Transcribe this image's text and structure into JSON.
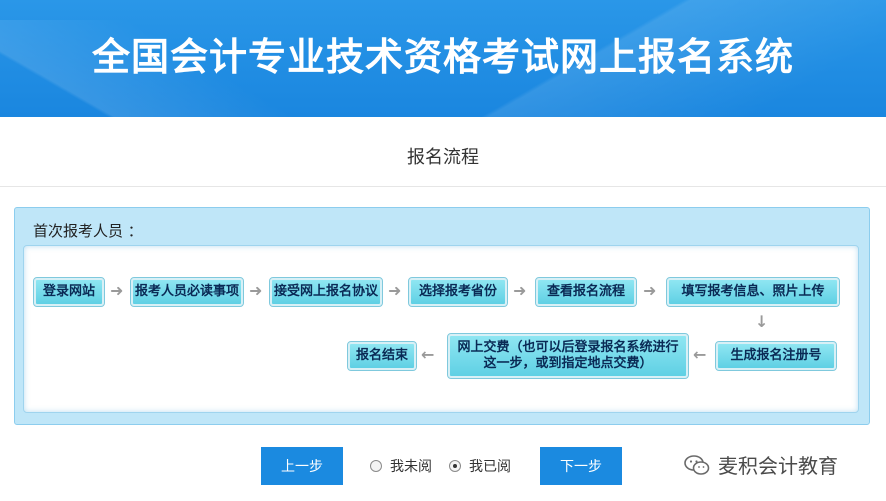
{
  "header": {
    "title": "全国会计专业技术资格考试网上报名系统"
  },
  "section": {
    "title": "报名流程"
  },
  "flow": {
    "label": "首次报考人员 ：",
    "steps_row1": [
      "登录网站",
      "报考人员必读事项",
      "接受网上报名协议",
      "选择报考省份",
      "查看报名流程",
      "填写报考信息、照片上传"
    ],
    "step_register": "生成报名注册号",
    "step_pay": "网上交费（也可以后登录报名系统进行这一步，或到指定地点交费）",
    "step_end": "报名结束"
  },
  "controls": {
    "prev_label": "上一步",
    "next_label": "下一步",
    "radio_unread": "我未阅",
    "radio_read": "我已阅",
    "selected": "我已阅"
  },
  "watermark": {
    "text": "麦积会计教育"
  },
  "colors": {
    "header_blue": "#1a86df",
    "button_blue": "#1b8ae0",
    "step_cyan": "#5fd0e4",
    "panel_bg": "#bfe6f8"
  }
}
